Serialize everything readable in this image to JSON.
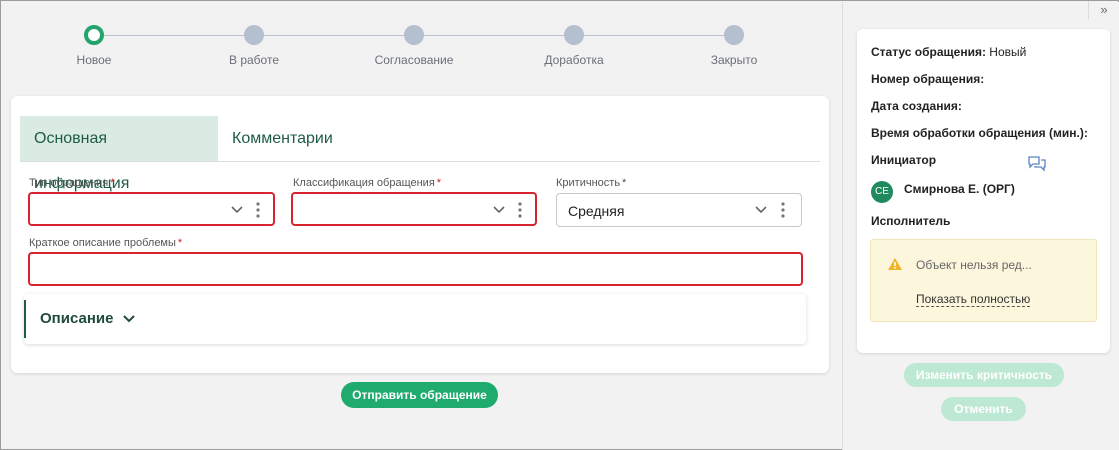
{
  "stepper": {
    "steps": [
      {
        "label": "Новое",
        "active": true
      },
      {
        "label": "В работе",
        "active": false
      },
      {
        "label": "Согласование",
        "active": false
      },
      {
        "label": "Доработка",
        "active": false
      },
      {
        "label": "Закрыто",
        "active": false
      }
    ]
  },
  "tabs": [
    {
      "label": "Основная информация",
      "active": true
    },
    {
      "label": "Комментарии",
      "active": false
    }
  ],
  "form": {
    "request_type": {
      "label": "Тип обращения",
      "required_mark": "*",
      "value": ""
    },
    "classification": {
      "label": "Классификация обращения",
      "required_mark": "*",
      "value": ""
    },
    "criticality": {
      "label": "Критичность",
      "required_mark": "*",
      "value": "Средняя"
    },
    "short_description": {
      "label": "Краткое описание проблемы",
      "required_mark": "*",
      "value": ""
    },
    "description_section": {
      "title": "Описание"
    }
  },
  "actions": {
    "submit_label": "Отправить обращение"
  },
  "right_panel": {
    "status_label": "Статус обращения:",
    "status_value": "Новый",
    "number_label": "Номер обращения:",
    "number_value": "",
    "created_label": "Дата создания:",
    "created_value": "",
    "processing_time_label": "Время обработки обращения (мин.):",
    "initiator_label": "Инициатор",
    "initiator": {
      "initials": "СЕ",
      "name": "Смирнова Е. (ОРГ)"
    },
    "executor_label": "Исполнитель",
    "warning": {
      "text": "Объект нельзя ред...",
      "link": "Показать полностью"
    },
    "change_criticality_label": "Изменить критичность",
    "cancel_label": "Отменить"
  },
  "colors": {
    "accent": "#1faa6e",
    "accent_light": "#bde8d3",
    "error": "#d8242e",
    "step_inactive": "#b4bfcf"
  },
  "icons": [
    "collapse-panel-icon",
    "chevron-down-icon",
    "more-vertical-icon",
    "chat-icon",
    "warning-icon"
  ]
}
